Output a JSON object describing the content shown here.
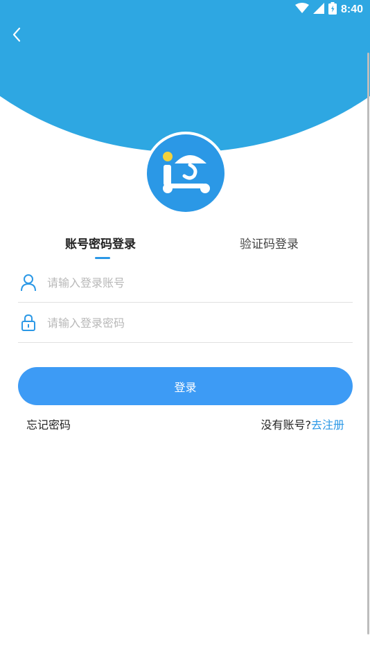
{
  "status_bar": {
    "time": "8:40",
    "icons": [
      "wifi-icon",
      "signal-icon",
      "battery-icon"
    ]
  },
  "nav": {
    "back_icon": "chevron-left-icon"
  },
  "logo": {
    "icon": "app-logo"
  },
  "tabs": [
    {
      "label": "账号密码登录",
      "active": true
    },
    {
      "label": "验证码登录",
      "active": false
    }
  ],
  "form": {
    "account_placeholder": "请输入登录账号",
    "account_value": "",
    "account_icon": "user-icon",
    "password_placeholder": "请输入登录密码",
    "password_value": "",
    "password_icon": "lock-icon"
  },
  "actions": {
    "login_label": "登录",
    "forgot_label": "忘记密码",
    "no_account_label": "没有账号?",
    "register_label": "去注册"
  },
  "colors": {
    "header": "#2ea7e2",
    "accent": "#2b98e6",
    "button": "#3d9bf5"
  }
}
